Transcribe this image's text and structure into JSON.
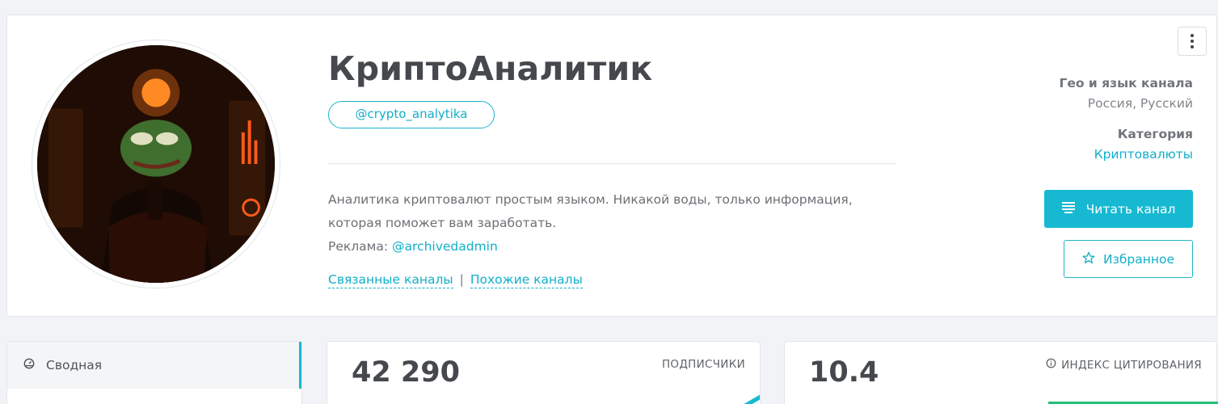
{
  "channel": {
    "title": "КриптоАналитик",
    "handle": "@crypto_analytika",
    "description_line1": "Аналитика криптовалют простым языком. Никакой воды, только информация,",
    "description_line2": "которая поможет вам заработать.",
    "ads_label": "Реклама:",
    "ads_contact": "@archivedadmin",
    "related_link": "Связанные каналы",
    "separator": "|",
    "similar_link": "Похожие каналы"
  },
  "meta": {
    "geo_heading": "Гео и язык канала",
    "geo_value": "Россия, Русский",
    "category_heading": "Категория",
    "category_value": "Криптовалюты"
  },
  "actions": {
    "read_label": "Читать канал",
    "favorite_label": "Избранное"
  },
  "nav": {
    "summary_label": "Сводная"
  },
  "stats": {
    "subscribers_value": "42 290",
    "subscribers_label": "ПОДПИСЧИКИ",
    "citation_value": "10.4",
    "citation_label": "ИНДЕКС ЦИТИРОВАНИЯ"
  },
  "icons": [
    "more-vertical-icon",
    "list-icon",
    "star-icon",
    "dashboard-icon",
    "info-icon"
  ],
  "colors": {
    "accent": "#17b9d2",
    "link": "#12afc8",
    "green": "#22c07a"
  }
}
